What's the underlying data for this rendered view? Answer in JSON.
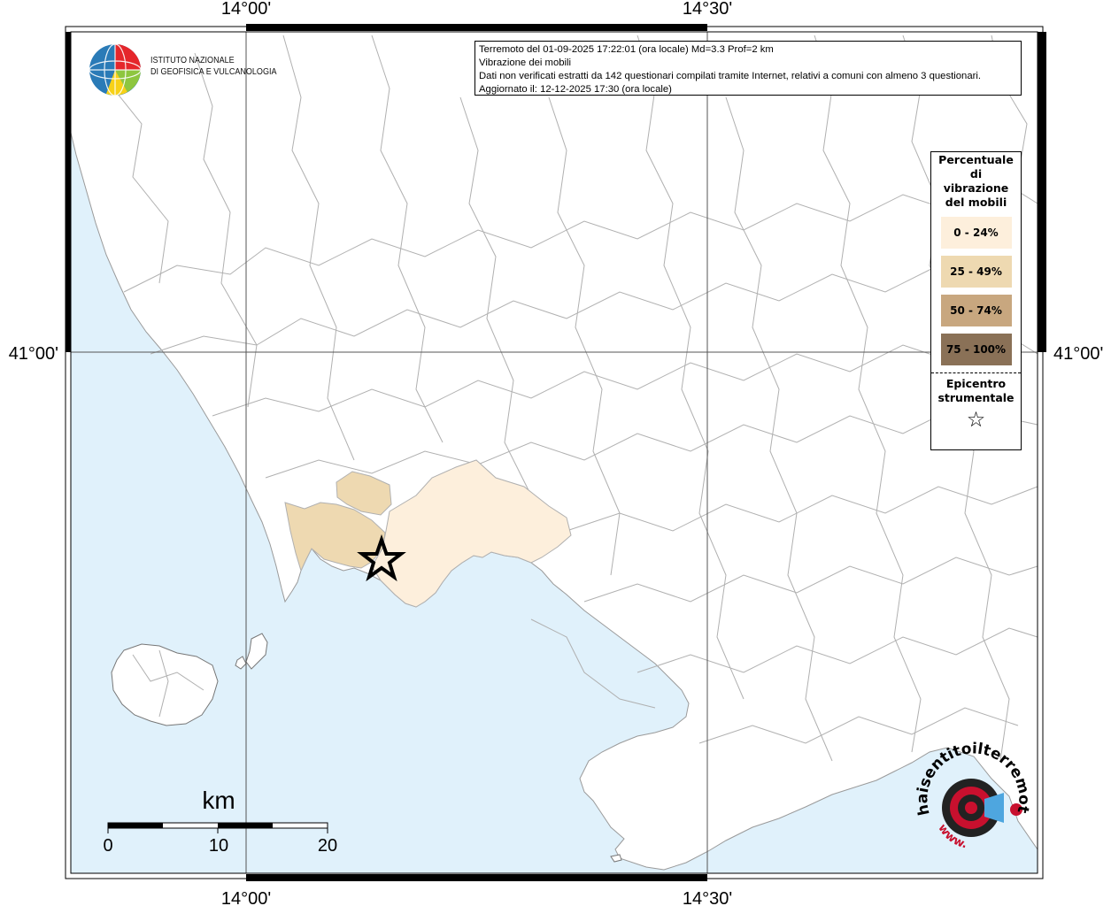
{
  "map": {
    "lon_ticks": [
      "14°00'",
      "14°30'"
    ],
    "lat_ticks": [
      "41°00'"
    ],
    "colors": {
      "sea": "#e0f1fb",
      "land": "#ffffff",
      "boundary": "#a9a9a9",
      "frame": "#000000",
      "grid": "#555555"
    }
  },
  "info": {
    "line1": "Terremoto del 01-09-2025 17:22:01 (ora locale) Md=3.3 Prof=2 km",
    "line2": "Vibrazione dei mobili",
    "line3": "Dati non verificati estratti da 142 questionari compilati tramite Internet, relativi a comuni con almeno 3 questionari.",
    "line4": "Aggiornato il: 12-12-2025 17:30 (ora locale)"
  },
  "legend": {
    "title": "Percentuale di vibrazione del mobili",
    "classes": [
      {
        "label": "0 - 24%",
        "color": "#fdefdc"
      },
      {
        "label": "25 - 49%",
        "color": "#eed9b1"
      },
      {
        "label": "50 - 74%",
        "color": "#c8a77f"
      },
      {
        "label": "75 - 100%",
        "color": "#8a7157"
      }
    ],
    "epicenter_title": "Epicentro strumentale",
    "epicenter_symbol": "☆"
  },
  "institute": {
    "name_line1": "ISTITUTO NAZIONALE",
    "name_line2": "DI GEOFISICA E VULCANOLOGIA"
  },
  "scalebar": {
    "unit": "km",
    "labels": [
      "0",
      "10",
      "20"
    ]
  },
  "watermark": {
    "text": "haisentitoilterremoto.it",
    "prefix": "www."
  },
  "affected": [
    {
      "class": 1
    },
    {
      "class": 1
    },
    {
      "class": 0
    }
  ]
}
